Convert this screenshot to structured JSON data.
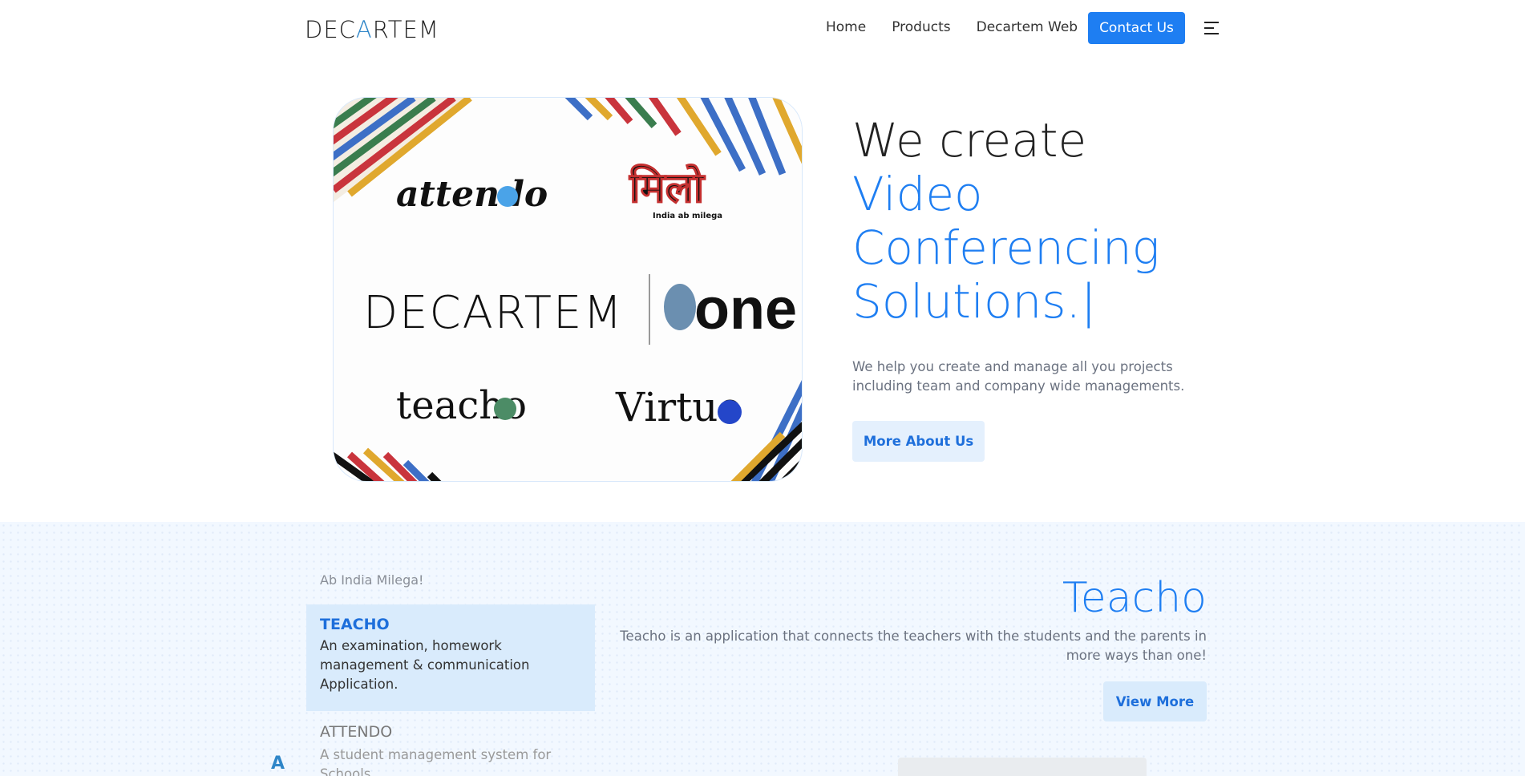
{
  "brand": {
    "logo_pre": "DEC",
    "logo_a": "A",
    "logo_post": "RTEM"
  },
  "nav": {
    "items": [
      "Home",
      "Products",
      "Decartem Web"
    ],
    "contact": "Contact Us"
  },
  "hero": {
    "line1": "We create",
    "line2": "Video",
    "line3": "Conferencing",
    "line4": "Solutions.|",
    "subtitle": "We help you create and manage all you projects including team and company wide managements.",
    "button": "More About Us"
  },
  "hero_image": {
    "attendo": "attendo",
    "milo": "मिलो",
    "milo_sub": "India ab milega",
    "decartem": "DECARTEM",
    "one": "one",
    "teacho": "teacho",
    "virtuo": "Virtuo"
  },
  "products": {
    "tagline": "Ab India Milega!",
    "active": {
      "title": "TEACHO",
      "desc": "An examination, homework management & communication Application."
    },
    "next": {
      "title": "ATTENDO",
      "desc": "A student management system for Schools"
    },
    "detail": {
      "title": "Teacho",
      "desc": "Teacho is an application that connects the teachers with the students and the parents in more ways than one!",
      "button": "View More"
    }
  },
  "colors": {
    "accent": "#1e7ef2",
    "light": "#e4f0fd"
  }
}
